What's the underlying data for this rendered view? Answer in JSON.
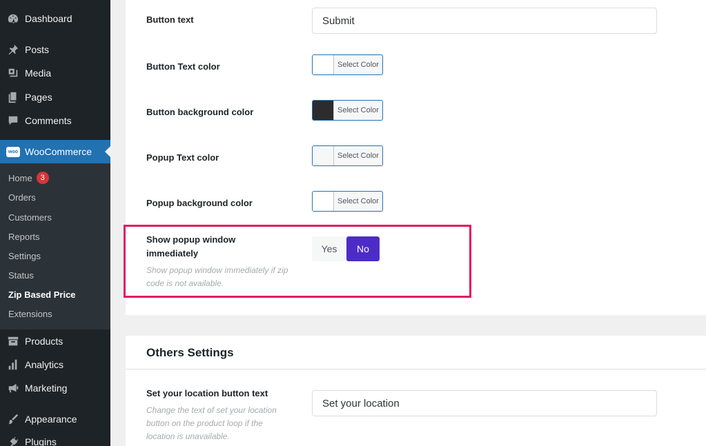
{
  "sidebar": {
    "items": [
      {
        "label": "Dashboard",
        "icon": "dashboard-icon"
      },
      {
        "label": "Posts",
        "icon": "pin-icon"
      },
      {
        "label": "Media",
        "icon": "media-icon"
      },
      {
        "label": "Pages",
        "icon": "pages-icon"
      },
      {
        "label": "Comments",
        "icon": "comment-icon"
      },
      {
        "label": "WooCommerce",
        "icon": "woo-icon",
        "logo_text": "woo"
      },
      {
        "label": "Products",
        "icon": "archive-icon"
      },
      {
        "label": "Analytics",
        "icon": "bar-chart-icon"
      },
      {
        "label": "Marketing",
        "icon": "megaphone-icon"
      },
      {
        "label": "Appearance",
        "icon": "brush-icon"
      },
      {
        "label": "Plugins",
        "icon": "plugin-icon"
      }
    ],
    "submenu": [
      {
        "label": "Home",
        "badge": "3"
      },
      {
        "label": "Orders"
      },
      {
        "label": "Customers"
      },
      {
        "label": "Reports"
      },
      {
        "label": "Settings"
      },
      {
        "label": "Status"
      },
      {
        "label": "Zip Based Price",
        "current": true
      },
      {
        "label": "Extensions"
      }
    ]
  },
  "settings": {
    "button_text": {
      "label": "Button text",
      "value": "Submit"
    },
    "button_text_color": {
      "label": "Button Text color",
      "button": "Select Color",
      "color": "#ffffff"
    },
    "button_bg_color": {
      "label": "Button background color",
      "button": "Select Color",
      "color": "#2c2c2c"
    },
    "popup_text_color": {
      "label": "Popup Text color",
      "button": "Select Color",
      "color": "#f6f7f7"
    },
    "popup_bg_color": {
      "label": "Popup background color",
      "button": "Select Color",
      "color": "#ffffff"
    },
    "show_popup": {
      "label": "Show popup window immediately",
      "description": "Show popup window immediately if zip code is not available.",
      "yes": "Yes",
      "no": "No",
      "selected": "No"
    }
  },
  "others": {
    "title": "Others Settings",
    "location_button": {
      "label": "Set your location button text",
      "description": "Change the text of set your location button on the product loop if the location is unavailable.",
      "value": "Set your location"
    }
  },
  "colors": {
    "sidebar_bg": "#1d2327",
    "active_blue": "#2271b1",
    "toggle_purple": "#4c2cc7",
    "highlight": "#e5145c"
  }
}
